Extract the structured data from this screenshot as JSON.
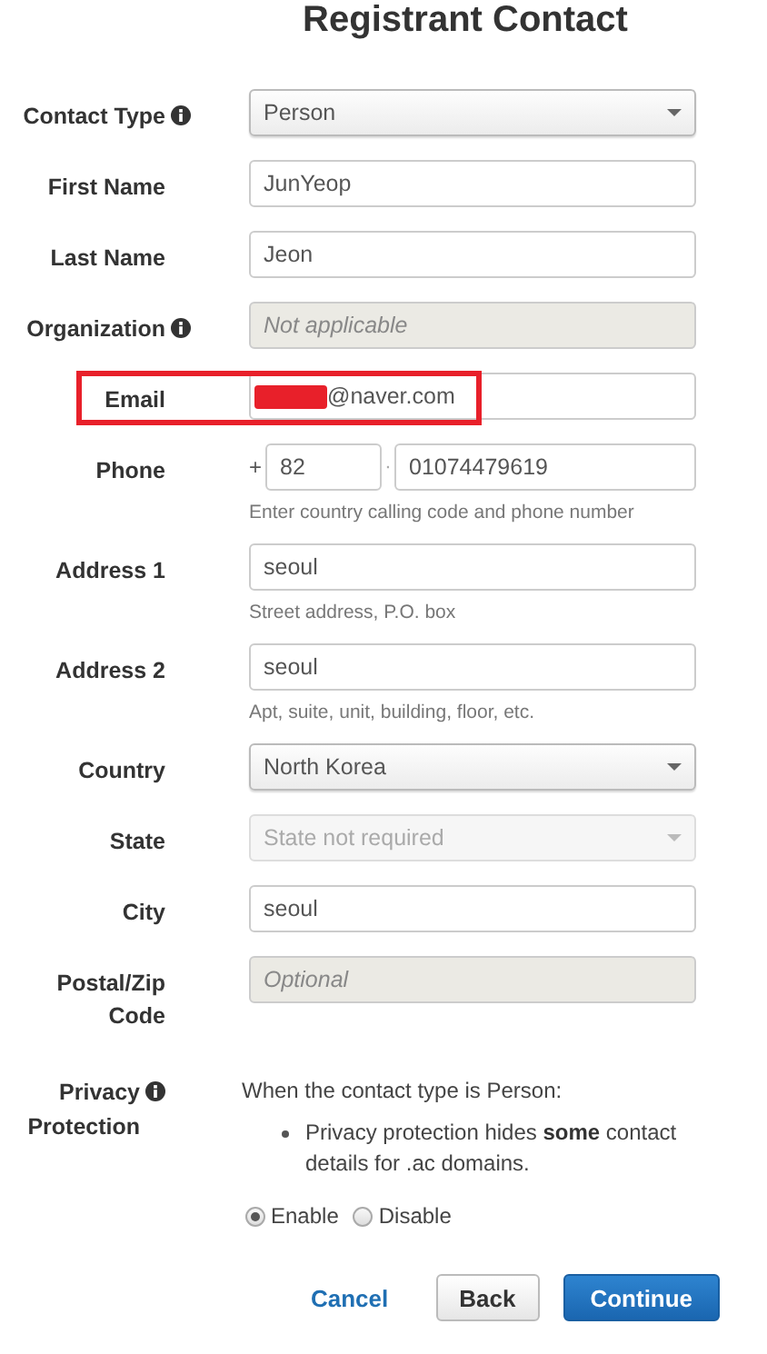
{
  "title": "Registrant Contact",
  "fields": [
    {
      "kind": "select",
      "label": "Contact Type",
      "info": true,
      "value": "Person",
      "disabled": false
    },
    {
      "kind": "text",
      "label": "First Name",
      "value": "JunYeop",
      "disabled": false
    },
    {
      "kind": "text",
      "label": "Last Name",
      "value": "Jeon",
      "disabled": false
    },
    {
      "kind": "text",
      "label": "Organization",
      "info": true,
      "placeholder": "Not applicable",
      "disabled": true
    },
    {
      "kind": "text",
      "label": "Email",
      "value": "@naver.com",
      "disabled": false,
      "redacted": true,
      "highlighted": true
    },
    {
      "kind": "phone",
      "label": "Phone",
      "prefix": "+",
      "code": "82",
      "separator": "·",
      "number": "01074479619",
      "hint": "Enter country calling code and phone number"
    },
    {
      "kind": "text",
      "label": "Address 1",
      "value": "seoul",
      "disabled": false,
      "hint": "Street address, P.O. box"
    },
    {
      "kind": "text",
      "label": "Address 2",
      "value": "seoul",
      "disabled": false,
      "hint": "Apt, suite, unit, building, floor, etc."
    },
    {
      "kind": "select",
      "label": "Country",
      "value": "North Korea",
      "disabled": false
    },
    {
      "kind": "select",
      "label": "State",
      "placeholder": "State not required",
      "disabled": true
    },
    {
      "kind": "text",
      "label": "City",
      "value": "seoul",
      "disabled": false
    },
    {
      "kind": "text",
      "label": "Postal/Zip Code",
      "placeholder": "Optional",
      "disabled": true
    }
  ],
  "privacy": {
    "label": "Privacy Protection",
    "info": true,
    "intro": "When the contact type is Person:",
    "bullets": [
      "Privacy protection hides **some** contact details for .ac domains."
    ],
    "options": [
      {
        "label": "Enable",
        "selected": true
      },
      {
        "label": "Disable",
        "selected": false
      }
    ]
  },
  "buttons": [
    {
      "kind": "link",
      "label": "Cancel"
    },
    {
      "kind": "default",
      "label": "Back"
    },
    {
      "kind": "primary",
      "label": "Continue"
    }
  ]
}
